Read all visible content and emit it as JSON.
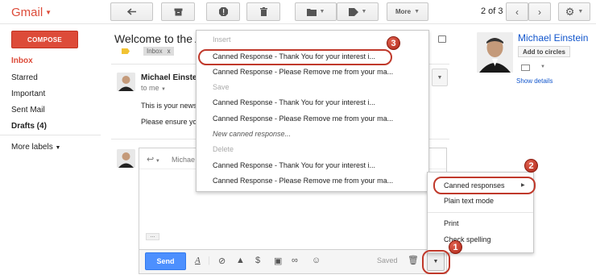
{
  "header": {
    "brand": "Gmail",
    "more_label": "More",
    "pager": "2 of 3"
  },
  "sidebar": {
    "compose_label": "COMPOSE",
    "items": [
      {
        "label": "Inbox",
        "active": true
      },
      {
        "label": "Starred"
      },
      {
        "label": "Important"
      },
      {
        "label": "Sent Mail"
      },
      {
        "label": "Drafts (4)"
      }
    ],
    "more_labels": "More labels"
  },
  "email": {
    "subject": "Welcome to the A",
    "label_inbox": "Inbox",
    "label_close": "x",
    "sender": "Michael Einstei",
    "to": "to me",
    "body_line1": "This is your news",
    "body_line2": "Please ensure yo"
  },
  "profile": {
    "name": "Michael Einstein",
    "add_circles": "Add to circles",
    "show_details": "Show details"
  },
  "reply": {
    "to_partial": "Michae",
    "send_label": "Send",
    "saved_label": "Saved",
    "dots": "..."
  },
  "canned_menu": {
    "insert_header": "Insert",
    "save_header": "Save",
    "delete_header": "Delete",
    "insert_items": [
      "Canned Response - Thank You for your interest i...",
      "Canned Response - Please Remove me from your ma..."
    ],
    "save_items": [
      "Canned Response - Thank You for your interest i...",
      "Canned Response - Please Remove me from your ma...",
      "New canned response..."
    ],
    "delete_items": [
      "Canned Response - Thank You for your interest i...",
      "Canned Response - Please Remove me from your ma..."
    ]
  },
  "more_menu": {
    "items": [
      "Canned responses",
      "Plain text mode",
      "Print",
      "Check spelling"
    ]
  },
  "callouts": [
    "1",
    "2",
    "3"
  ],
  "colors": {
    "brand_red": "#dd4b39",
    "send_blue": "#4d90fe",
    "link_blue": "#1155cc",
    "callout_red": "#c0392b"
  }
}
